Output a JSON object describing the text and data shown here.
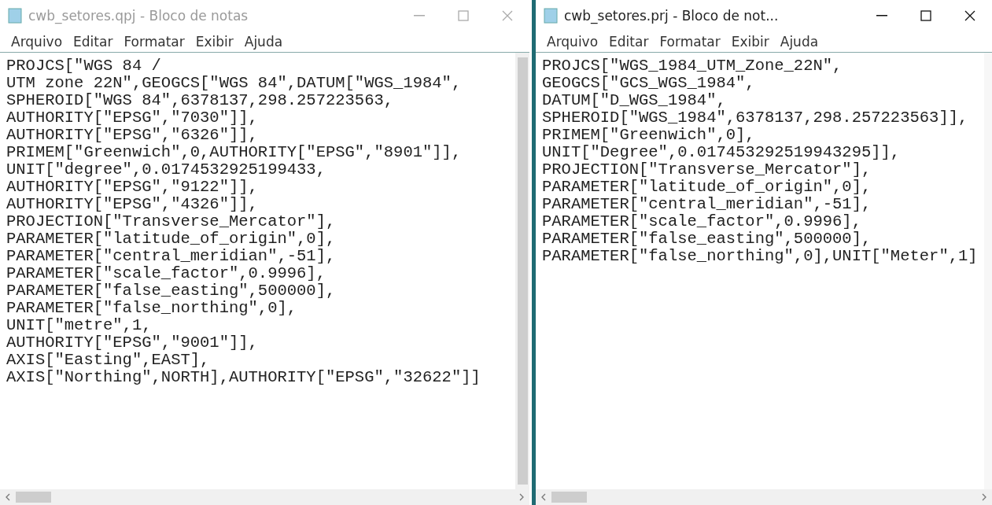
{
  "windows": [
    {
      "title": "cwb_setores.qpj - Bloco de notas",
      "active": false,
      "menu": [
        "Arquivo",
        "Editar",
        "Formatar",
        "Exibir",
        "Ajuda"
      ],
      "vertical_scrollbar": true,
      "lines": [
        "PROJCS[\"WGS 84 /",
        "UTM zone 22N\",GEOGCS[\"WGS 84\",DATUM[\"WGS_1984\",",
        "SPHEROID[\"WGS 84\",6378137,298.257223563,",
        "AUTHORITY[\"EPSG\",\"7030\"]],",
        "AUTHORITY[\"EPSG\",\"6326\"]],",
        "PRIMEM[\"Greenwich\",0,AUTHORITY[\"EPSG\",\"8901\"]],",
        "UNIT[\"degree\",0.0174532925199433,",
        "AUTHORITY[\"EPSG\",\"9122\"]],",
        "AUTHORITY[\"EPSG\",\"4326\"]],",
        "PROJECTION[\"Transverse_Mercator\"],",
        "PARAMETER[\"latitude_of_origin\",0],",
        "PARAMETER[\"central_meridian\",-51],",
        "PARAMETER[\"scale_factor\",0.9996],",
        "PARAMETER[\"false_easting\",500000],",
        "PARAMETER[\"false_northing\",0],",
        "UNIT[\"metre\",1,",
        "AUTHORITY[\"EPSG\",\"9001\"]],",
        "AXIS[\"Easting\",EAST],",
        "AXIS[\"Northing\",NORTH],AUTHORITY[\"EPSG\",\"32622\"]]"
      ]
    },
    {
      "title": "cwb_setores.prj - Bloco de not...",
      "active": true,
      "menu": [
        "Arquivo",
        "Editar",
        "Formatar",
        "Exibir",
        "Ajuda"
      ],
      "vertical_scrollbar": false,
      "lines": [
        "PROJCS[\"WGS_1984_UTM_Zone_22N\",",
        "GEOGCS[\"GCS_WGS_1984\",",
        "DATUM[\"D_WGS_1984\",",
        "SPHEROID[\"WGS_1984\",6378137,298.257223563]],",
        "PRIMEM[\"Greenwich\",0],",
        "UNIT[\"Degree\",0.017453292519943295]],",
        "PROJECTION[\"Transverse_Mercator\"],",
        "PARAMETER[\"latitude_of_origin\",0],",
        "PARAMETER[\"central_meridian\",-51],",
        "PARAMETER[\"scale_factor\",0.9996],",
        "PARAMETER[\"false_easting\",500000],",
        "PARAMETER[\"false_northing\",0],UNIT[\"Meter\",1]"
      ]
    }
  ]
}
